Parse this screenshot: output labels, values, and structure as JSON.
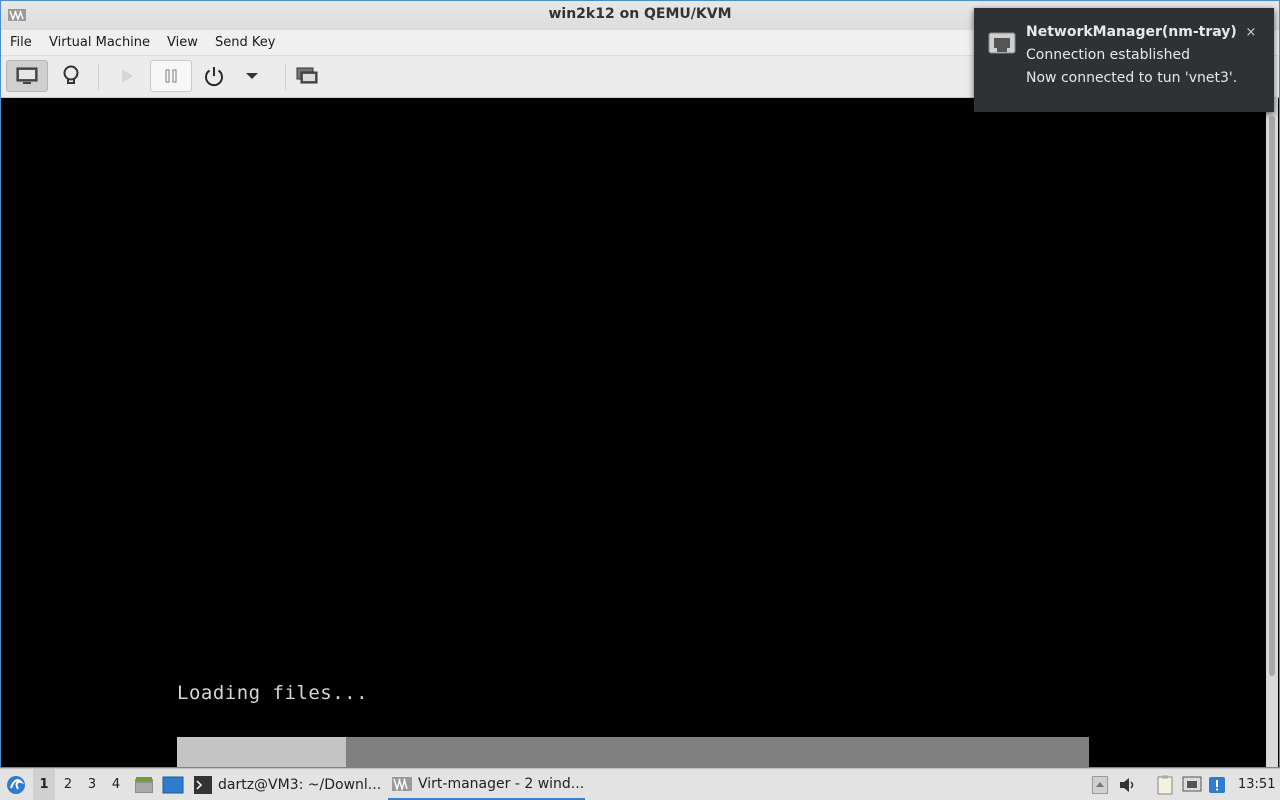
{
  "window": {
    "title": "win2k12 on QEMU/KVM"
  },
  "menu": [
    "File",
    "Virtual Machine",
    "View",
    "Send Key"
  ],
  "toolbar": {
    "buttons": [
      "console-icon",
      "details-lightbulb-icon",
      "run-icon",
      "pause-icon",
      "power-icon",
      "dropdown-arrow-icon",
      "fullscreen-icon"
    ]
  },
  "vm_display": {
    "loading_text": "Loading files...",
    "progress": 0.185
  },
  "notification": {
    "title": "NetworkManager(nm-tray)",
    "line1": "Connection established",
    "line2": "Now connected to tun 'vnet3'.",
    "close": "×"
  },
  "taskbar": {
    "desktops": [
      "1",
      "2",
      "3",
      "4"
    ],
    "active_desktop": "1",
    "tasks": [
      {
        "label": "dartz@VM3: ~/Downl..."
      },
      {
        "label": "Virt-manager - 2 wind..."
      }
    ],
    "clock": "13:51"
  },
  "colors": {
    "accent": "#3a80d0",
    "notification_bg": "#2f3234"
  }
}
